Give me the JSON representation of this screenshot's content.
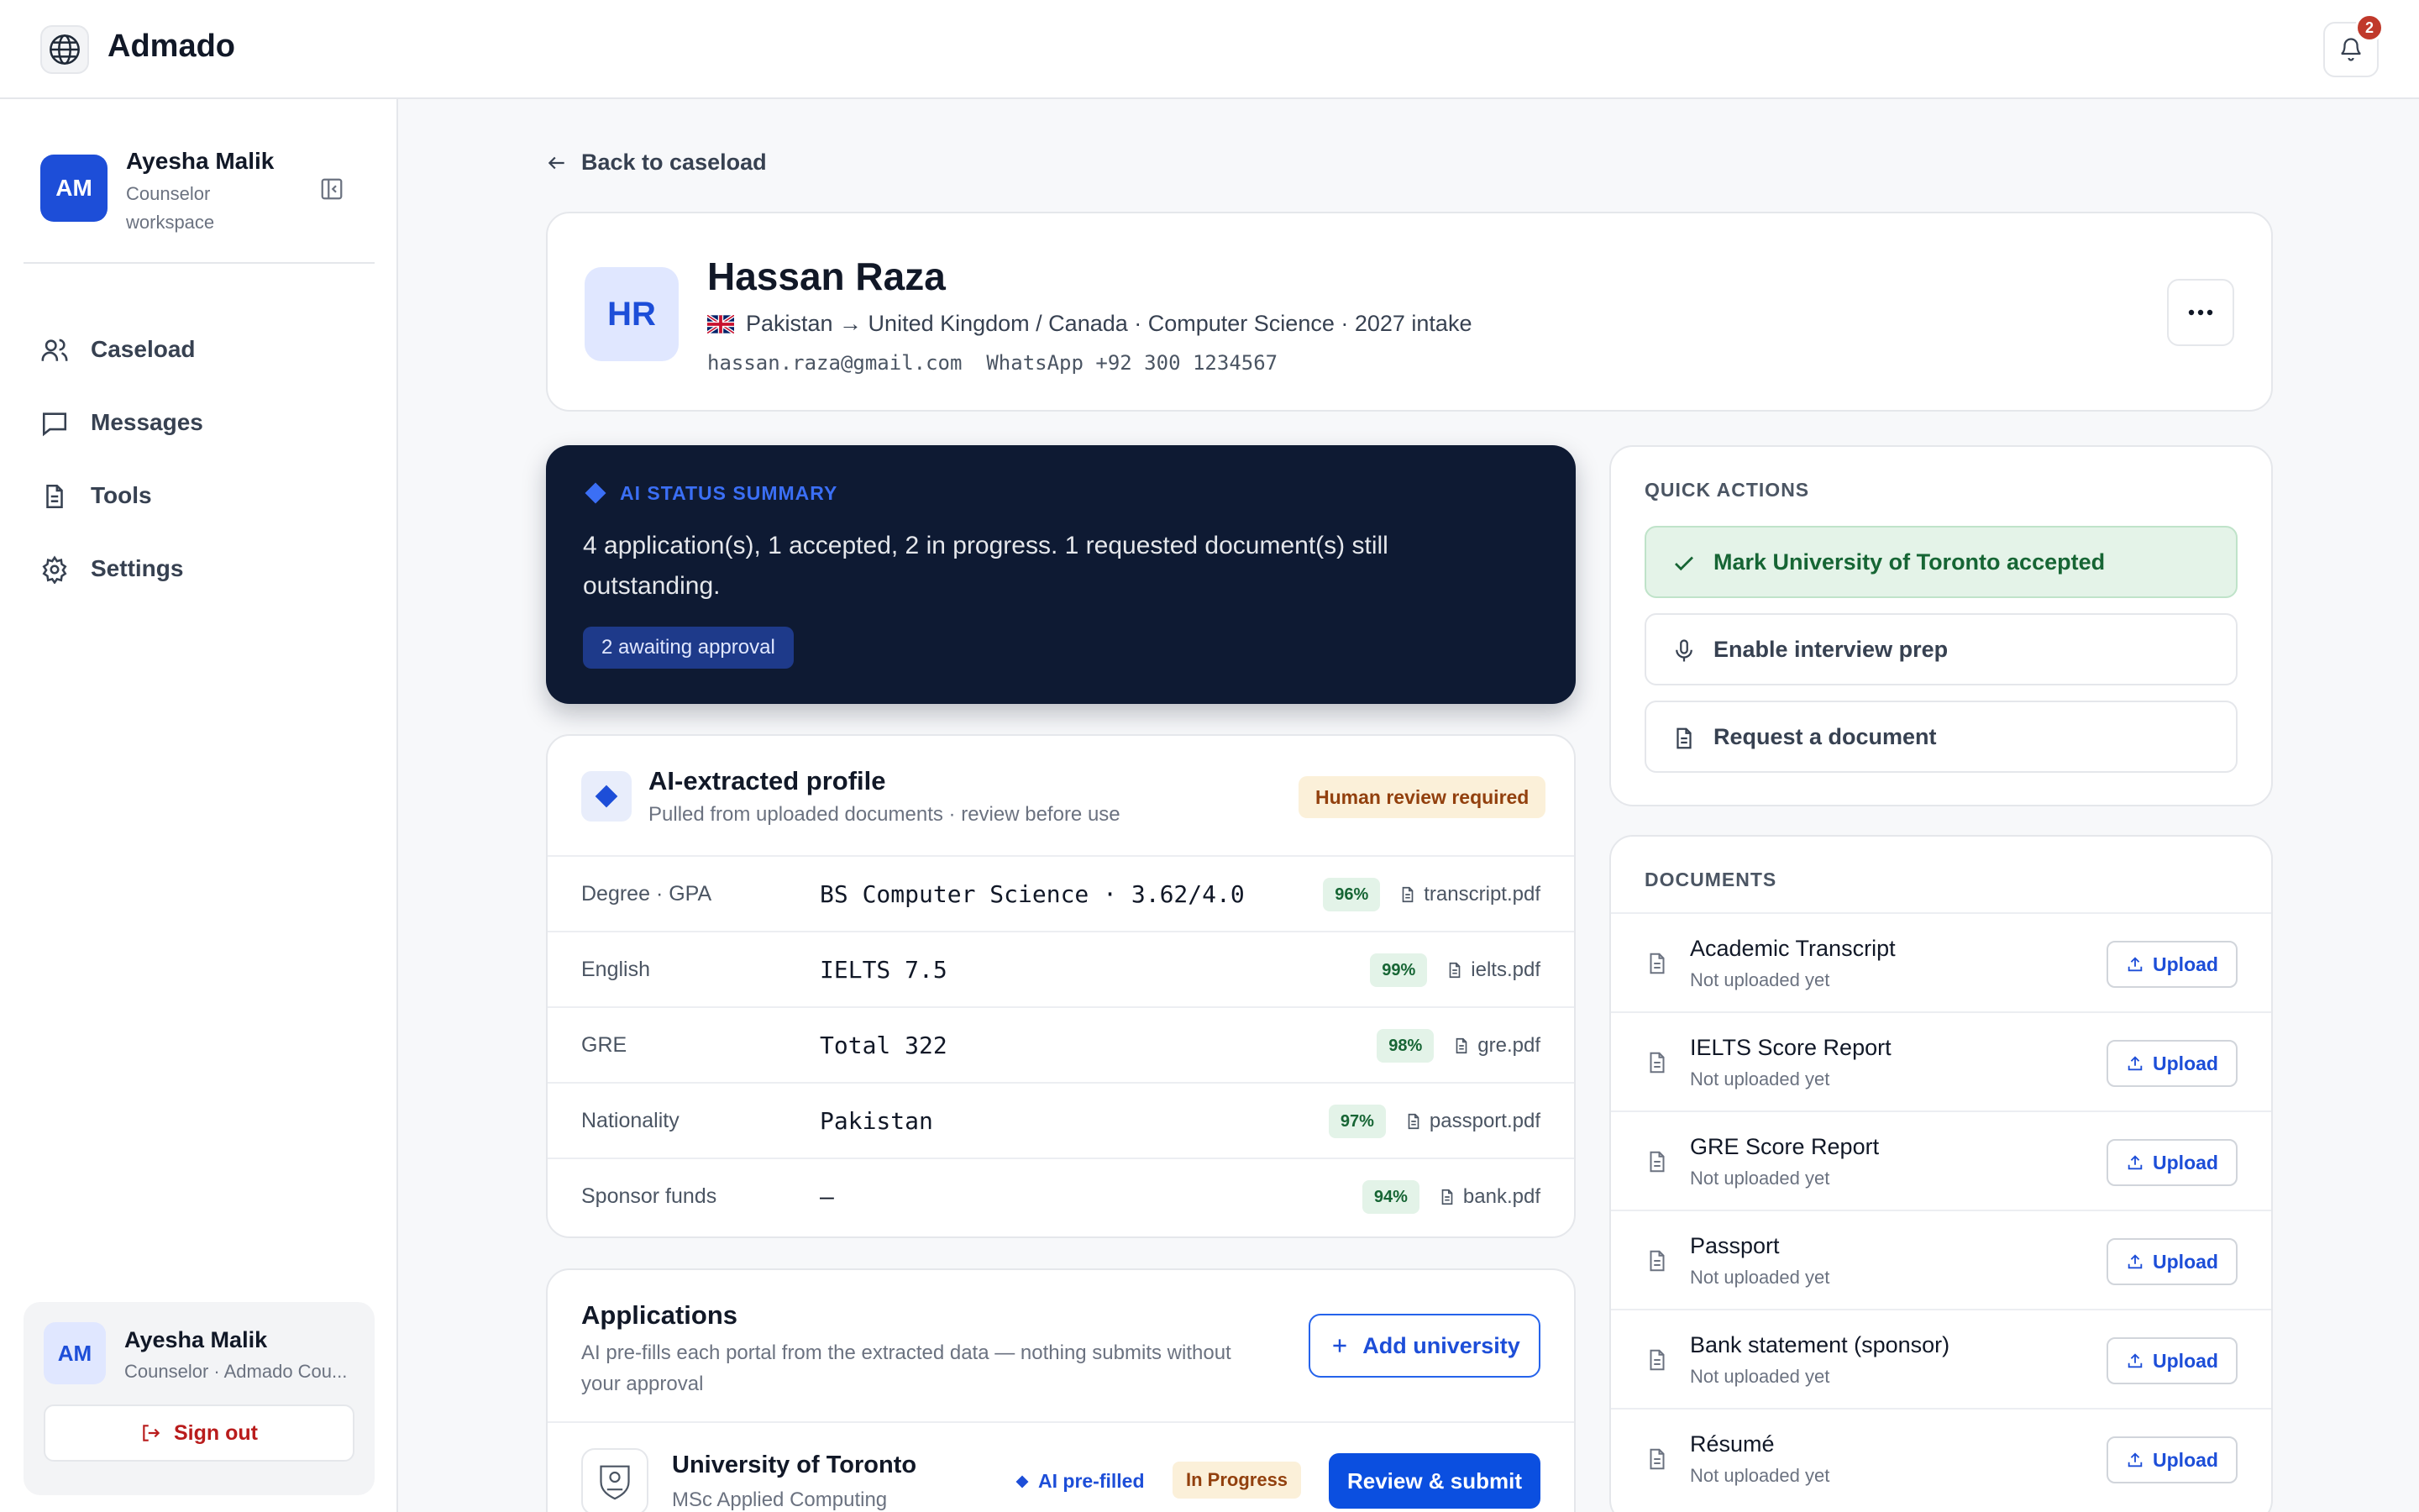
{
  "app": {
    "name": "Admado",
    "notifications": "2"
  },
  "sidebar": {
    "user": {
      "initials": "AM",
      "name": "Ayesha Malik",
      "role": "Counselor workspace"
    },
    "nav": [
      {
        "label": "Caseload",
        "icon": "users-icon"
      },
      {
        "label": "Messages",
        "icon": "message-icon"
      },
      {
        "label": "Tools",
        "icon": "document-icon"
      },
      {
        "label": "Settings",
        "icon": "gear-icon"
      }
    ],
    "footer": {
      "initials": "AM",
      "name": "Ayesha Malik",
      "role": "Counselor · Admado Cou...",
      "signout": "Sign out"
    }
  },
  "back_label": "Back to caseload",
  "student": {
    "initials": "HR",
    "name": "Hassan Raza",
    "route": "Pakistan → United Kingdom / Canada · Computer Science · 2027 intake",
    "email": "hassan.raza@gmail.com",
    "whatsapp": "WhatsApp +92 300 1234567"
  },
  "ai_summary": {
    "label": "AI STATUS SUMMARY",
    "text": "4 application(s), 1 accepted, 2 in progress. 1 requested document(s) still outstanding.",
    "chip": "2 awaiting approval"
  },
  "profile": {
    "title": "AI-extracted profile",
    "subtitle": "Pulled from uploaded documents · review before use",
    "badge": "Human review required",
    "rows": [
      {
        "key": "Degree · GPA",
        "value": "BS Computer Science · 3.62/4.0",
        "confidence": "96%",
        "file": "transcript.pdf"
      },
      {
        "key": "English",
        "value": "IELTS 7.5",
        "confidence": "99%",
        "file": "ielts.pdf"
      },
      {
        "key": "GRE",
        "value": "Total 322",
        "confidence": "98%",
        "file": "gre.pdf"
      },
      {
        "key": "Nationality",
        "value": "Pakistan",
        "confidence": "97%",
        "file": "passport.pdf"
      },
      {
        "key": "Sponsor funds",
        "value": "—",
        "confidence": "94%",
        "file": "bank.pdf"
      }
    ]
  },
  "applications": {
    "title": "Applications",
    "subtitle": "AI pre-fills each portal from the extracted data — nothing submits without your approval",
    "add_label": "Add university",
    "items": [
      {
        "name": "University of Toronto",
        "program": "MSc Applied Computing",
        "ai_label": "AI pre-filled",
        "status": "In Progress",
        "action": "Review & submit"
      }
    ]
  },
  "quick_actions": {
    "label": "QUICK ACTIONS",
    "items": [
      {
        "label": "Mark University of Toronto accepted",
        "icon": "check-icon"
      },
      {
        "label": "Enable interview prep",
        "icon": "microphone-icon"
      },
      {
        "label": "Request a document",
        "icon": "document-icon"
      }
    ]
  },
  "documents": {
    "label": "DOCUMENTS",
    "upload_label": "Upload",
    "items": [
      {
        "name": "Academic Transcript",
        "status": "Not uploaded yet"
      },
      {
        "name": "IELTS Score Report",
        "status": "Not uploaded yet"
      },
      {
        "name": "GRE Score Report",
        "status": "Not uploaded yet"
      },
      {
        "name": "Passport",
        "status": "Not uploaded yet"
      },
      {
        "name": "Bank statement (sponsor)",
        "status": "Not uploaded yet"
      },
      {
        "name": "Résumé",
        "status": "Not uploaded yet"
      }
    ]
  },
  "colors": {
    "accent": "#0b4fe0",
    "ai_card_bg": "#0e1a33",
    "accepted_bg": "#e4f3e8",
    "warning_bg": "#fbf0d9"
  }
}
